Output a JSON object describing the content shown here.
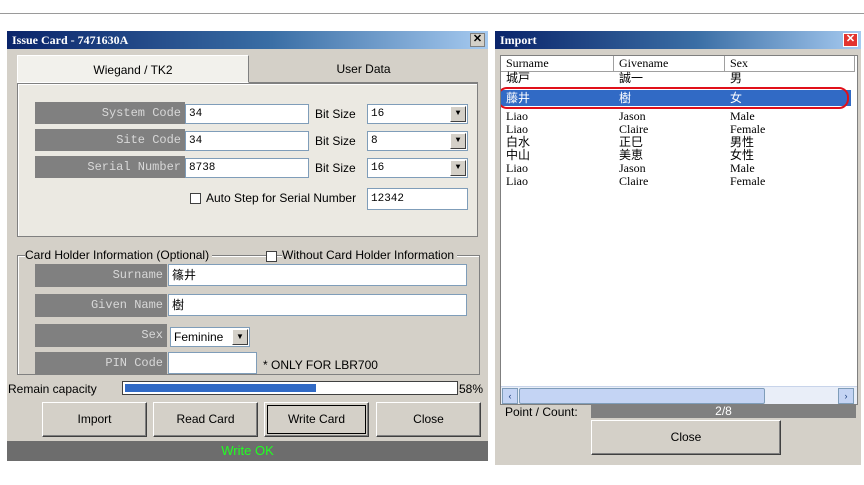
{
  "issue_window": {
    "title": "Issue Card - 7471630A",
    "close_glyph": "✕",
    "tabs": [
      {
        "label": "Wiegand / TK2"
      },
      {
        "label": "User Data"
      }
    ],
    "card_fields": {
      "system_code": {
        "label": "System Code",
        "value": "34",
        "bit_size_label": "Bit Size",
        "bit_size": "16"
      },
      "site_code": {
        "label": "Site Code",
        "value": "34",
        "bit_size_label": "Bit Size",
        "bit_size": "8"
      },
      "serial_number": {
        "label": "Serial Number",
        "value": "8738",
        "bit_size_label": "Bit Size",
        "bit_size": "16"
      }
    },
    "auto_step": {
      "label": "Auto Step for Serial Number",
      "value": "12342",
      "checked": false
    },
    "holder": {
      "group_label": "Card Holder Information (Optional)",
      "without_label": "Without Card Holder Information",
      "without_checked": false,
      "surname_label": "Surname",
      "surname": "篠井",
      "given_label": "Given Name",
      "given": "樹",
      "sex_label": "Sex",
      "sex": "Feminine",
      "pin_label": "PIN Code",
      "pin": "",
      "pin_note": "* ONLY FOR LBR700"
    },
    "remain": {
      "label": "Remain capacity",
      "percent_text": "58%",
      "fraction": 0.58
    },
    "buttons": {
      "import": "Import",
      "read": "Read Card",
      "write": "Write Card",
      "close": "Close"
    },
    "status": "Write OK",
    "colors": {
      "status_text": "#21ff21",
      "progress": "#316ac5"
    }
  },
  "import_window": {
    "title": "Import",
    "close_glyph": "✕",
    "columns": [
      "Surname",
      "Givename",
      "Sex"
    ],
    "rows": [
      {
        "surname": "城戸",
        "givename": "誠一",
        "sex": "男"
      },
      {
        "surname": "藤井",
        "givename": "樹",
        "sex": "女"
      },
      {
        "surname": "Liao",
        "givename": "Jason",
        "sex": "Male"
      },
      {
        "surname": "Liao",
        "givename": "Claire",
        "sex": "Female"
      },
      {
        "surname": "白水",
        "givename": "正巳",
        "sex": "男性"
      },
      {
        "surname": "中山",
        "givename": "美恵",
        "sex": "女性"
      },
      {
        "surname": "Liao",
        "givename": "Jason",
        "sex": "Male"
      },
      {
        "surname": "Liao",
        "givename": "Claire",
        "sex": "Female"
      }
    ],
    "selected_row": 1,
    "scroll_left": "‹",
    "scroll_right": "›",
    "point_count_label": "Point / Count:",
    "point_count_value": "2/8",
    "close_button": "Close",
    "highlight_color": "#e0101a"
  },
  "icons": {
    "dropdown": "▼",
    "check": ""
  }
}
